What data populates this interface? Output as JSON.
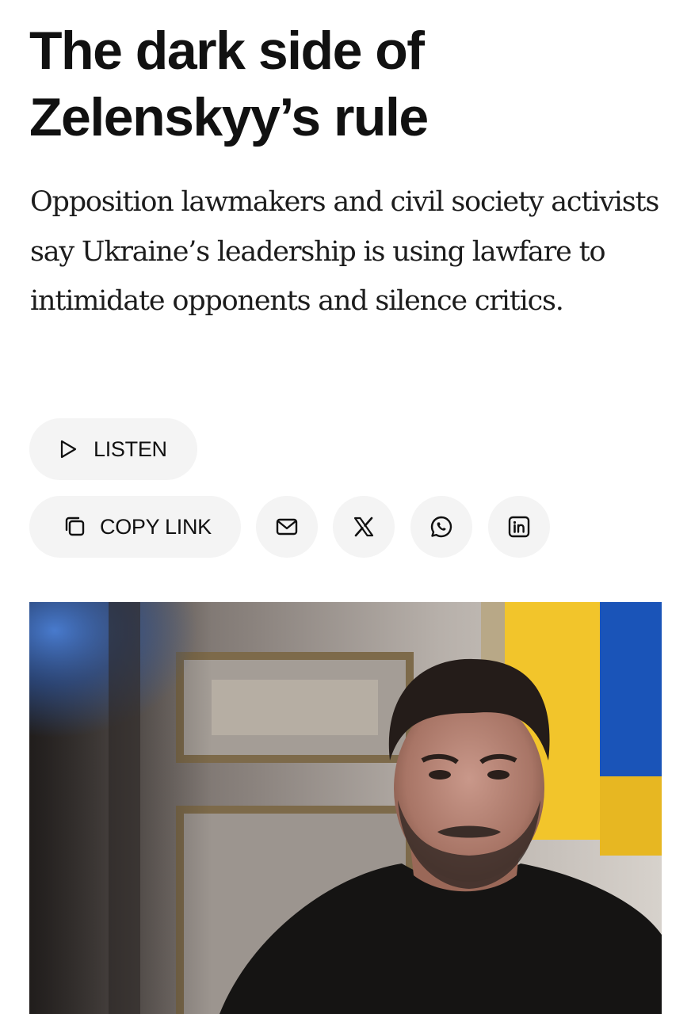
{
  "article": {
    "headline_line1": "The dark side of",
    "headline_line2": "Zelenskyy’s rule",
    "dek": "Opposition lawmakers and civil society activists say Ukraine’s leadership is using lawfare to intimidate opponents and silence critics."
  },
  "actions": {
    "listen_label": "LISTEN",
    "copy_link_label": "COPY LINK",
    "share_icons": [
      "envelope-icon",
      "x-logo-icon",
      "whatsapp-icon",
      "linkedin-icon"
    ]
  },
  "colors": {
    "text": "#111111",
    "button_bg": "#f4f4f4",
    "flag_yellow": "#f2c52b",
    "flag_blue": "#1a54b8"
  }
}
